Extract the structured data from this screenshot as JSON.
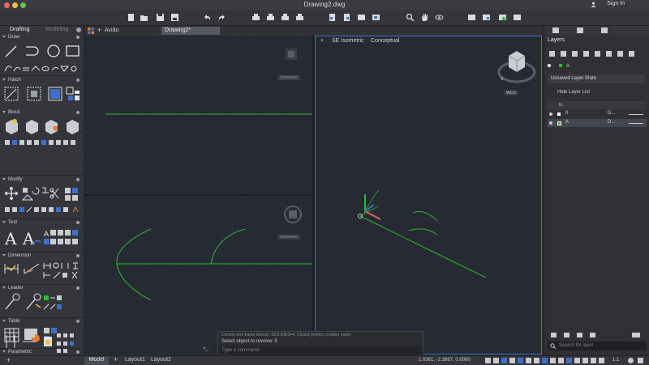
{
  "window": {
    "title": "Drawing2.dwg",
    "sign_in": "Sign In"
  },
  "palette": {
    "tabs": [
      "Drafting",
      "Modeling"
    ],
    "sections": [
      {
        "label": "Draw"
      },
      {
        "label": "Hatch"
      },
      {
        "label": "Block"
      },
      {
        "label": "Modify"
      },
      {
        "label": "Text"
      },
      {
        "label": "Dimension"
      },
      {
        "label": "Leader"
      },
      {
        "label": "Table"
      },
      {
        "label": "Parametric"
      }
    ]
  },
  "doc_tabs": {
    "avia": "Avião",
    "drawing": "Drawing2*"
  },
  "viewports": {
    "iso_label": "SE Isometric",
    "visual_style": "Conceptual",
    "iso_prefix": "+",
    "unnamed": "Unnamed",
    "wcs": "WCS"
  },
  "layers": {
    "title": "Layers",
    "current": "A",
    "state": "Unsaved Layer State",
    "hide_list": "Hide Layer List",
    "header_name": "N..",
    "rows": [
      {
        "name": "0",
        "lt": "D...",
        "color": "#ffffff"
      },
      {
        "name": "A",
        "lt": "D...",
        "color": "#22c02a"
      }
    ],
    "search_placeholder": "Search for layer"
  },
  "command": {
    "history": "Current wire frame density: ISOLINES=4, Closed profiles creation mode",
    "line": "Select object to revolve: 5",
    "placeholder": "Type a command"
  },
  "status": {
    "model": "Model",
    "layout1": "Layout1",
    "layout2": "Layout2",
    "coords": "1.0361, -2.3867, 0.0000",
    "scale": "1:1"
  }
}
